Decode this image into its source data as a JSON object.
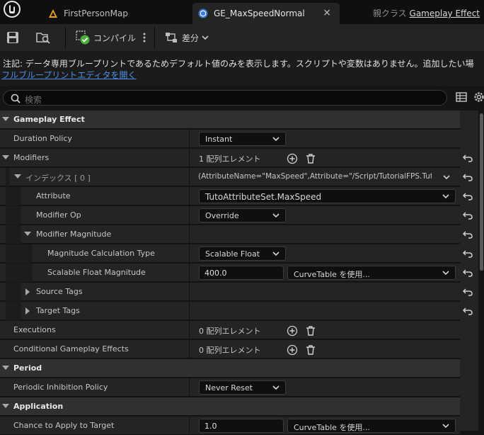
{
  "tabs": [
    {
      "label": "FirstPersonMap"
    },
    {
      "label": "GE_MaxSpeedNormal",
      "close": "×"
    }
  ],
  "parent_class": {
    "prefix": "親クラス",
    "link": "Gameplay Effect"
  },
  "toolbar": {
    "compile_label": "コンパイル",
    "diff_label": "差分"
  },
  "notice": {
    "line1": "注記:   データ専用ブループリントであるためデフォルト値のみを表示します。スクリプトや変数はありません。追加したい場",
    "link": "フルブループリントエディタを開く"
  },
  "search": {
    "placeholder": "検索"
  },
  "rows": {
    "gameplay_effect": "Gameplay Effect",
    "duration_policy": {
      "name": "Duration Policy",
      "value": "Instant"
    },
    "modifiers": {
      "name": "Modifiers",
      "value": "1 配列エレメント"
    },
    "index0": {
      "name": "インデックス [ 0 ]",
      "value": "(AttributeName=\"MaxSpeed\",Attribute=\"/Script/TutorialFPS.Tuto"
    },
    "attribute": {
      "name": "Attribute",
      "value": "TutoAttributeSet.MaxSpeed"
    },
    "modifier_op": {
      "name": "Modifier Op",
      "value": "Override"
    },
    "modifier_magnitude": {
      "name": "Modifier Magnitude"
    },
    "mag_calc_type": {
      "name": "Magnitude Calculation Type",
      "value": "Scalable Float"
    },
    "scalable_float": {
      "name": "Scalable Float Magnitude",
      "value": "400.0",
      "curve": "CurveTable を使用..."
    },
    "source_tags": {
      "name": "Source Tags"
    },
    "target_tags": {
      "name": "Target Tags"
    },
    "executions": {
      "name": "Executions",
      "value": "0 配列エレメント"
    },
    "conditional": {
      "name": "Conditional Gameplay Effects",
      "value": "0 配列エレメント"
    },
    "period": "Period",
    "periodic_inhibition": {
      "name": "Periodic Inhibition Policy",
      "value": "Never Reset"
    },
    "application": "Application",
    "chance": {
      "name": "Chance to Apply to Target",
      "value": "1.0",
      "curve": "CurveTable を使用..."
    }
  },
  "colors": {
    "accent": "#4e8ee6",
    "panel": "#242424",
    "category": "#303030",
    "background": "#151515"
  }
}
